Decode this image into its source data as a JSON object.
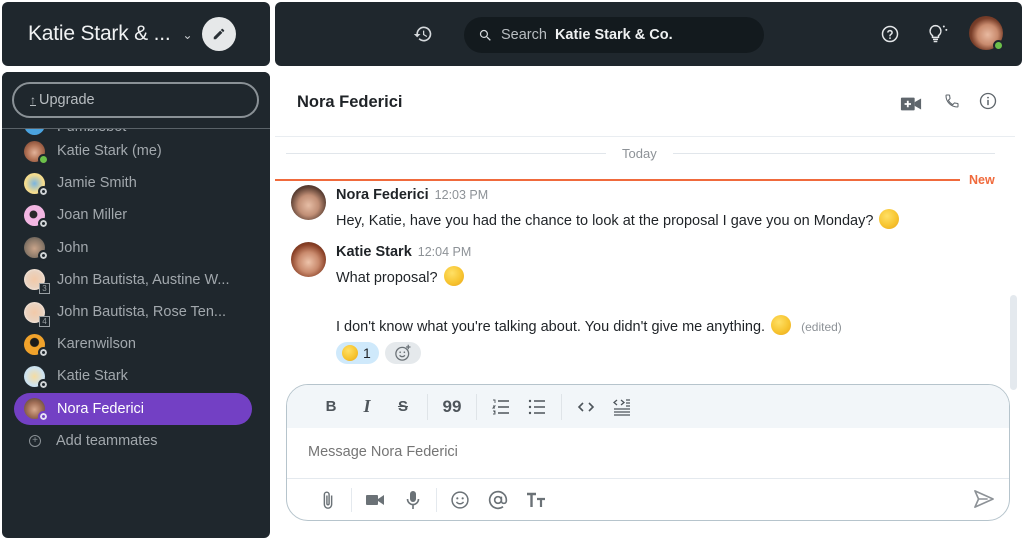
{
  "workspace": {
    "title": "Katie Stark & ...",
    "edit_tooltip": "New message"
  },
  "topbar": {
    "search_label": "Search",
    "search_scope": "Katie Stark & Co."
  },
  "sidebar": {
    "upgrade_label": "Upgrade",
    "items": [
      {
        "label": "Pumblebot",
        "avatar_color": "#4aa3df",
        "status": "none"
      },
      {
        "label": "Katie Stark (me)",
        "avatar_color": "#a86a52",
        "status": "online"
      },
      {
        "label": "Jamie Smith",
        "avatar_color": "#f1d98a",
        "status": "away"
      },
      {
        "label": "Joan Miller",
        "avatar_color": "#f2b6e2",
        "status": "away"
      },
      {
        "label": "John",
        "avatar_color": "#8c7a6a",
        "status": "away"
      },
      {
        "label": "John Bautista, Austine W...",
        "avatar_color": "#e9d2bf",
        "status": "group",
        "count": "3"
      },
      {
        "label": "John Bautista, Rose Ten...",
        "avatar_color": "#e9d2bf",
        "status": "group",
        "count": "4"
      },
      {
        "label": "Karenwilson",
        "avatar_color": "#f0a22b",
        "status": "away"
      },
      {
        "label": "Katie Stark",
        "avatar_color": "#cfe3ef",
        "status": "away"
      },
      {
        "label": "Nora Federici",
        "avatar_color": "#7a5848",
        "status": "away",
        "active": true
      }
    ],
    "add_teammates_label": "Add teammates",
    "accent_color": "#7340c4"
  },
  "chat": {
    "title": "Nora Federici",
    "day_divider": "Today",
    "new_label": "New",
    "messages": [
      {
        "author": "Nora Federici",
        "time": "12:03 PM",
        "lines": [
          "Hey, Katie, have you had the chance to look at the proposal I gave you on Monday?"
        ],
        "emoji": "smiling-face"
      },
      {
        "author": "Katie Stark",
        "time": "12:04 PM",
        "lines": [
          "What proposal?",
          "I don't know what you're talking about. You didn't give me anything."
        ],
        "emojis": [
          "hushed-face",
          "thinking-face"
        ],
        "edited_label": "(edited)"
      }
    ],
    "reactions": [
      {
        "emoji": "shushing-face",
        "count": "1",
        "mine": true
      }
    ]
  },
  "composer": {
    "placeholder": "Message Nora Federici",
    "format_tools": [
      "bold",
      "italic",
      "strikethrough",
      "quote",
      "ordered-list",
      "bullet-list",
      "code",
      "code-block"
    ],
    "actions": [
      "attach",
      "video-message",
      "audio-message",
      "emoji",
      "mention",
      "text-format"
    ]
  }
}
